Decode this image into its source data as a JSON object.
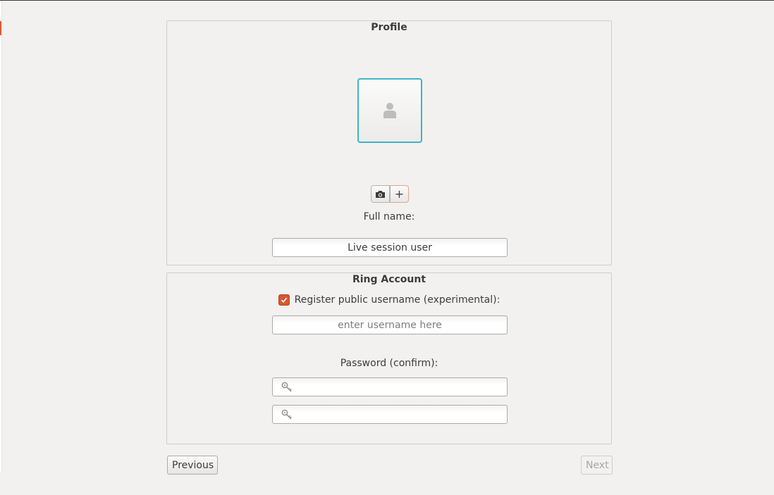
{
  "profile": {
    "title": "Profile",
    "avatar_icon": "person-icon",
    "camera_icon": "camera-icon",
    "add_symbol": "+",
    "fullname_label": "Full name:",
    "fullname_value": "Live session user"
  },
  "ring_account": {
    "title": "Ring Account",
    "register_label": "Register public username (experimental):",
    "register_checked": true,
    "username_placeholder": "enter username here",
    "username_value": "",
    "password_label": "Password (confirm):",
    "password_icon": "key-icon",
    "password_value": "",
    "password_confirm_value": ""
  },
  "nav": {
    "previous_label": "Previous",
    "next_label": "Next",
    "next_enabled": false
  },
  "colors": {
    "accent": "#d9562f",
    "avatar_border": "#3db5c6",
    "background": "#f2f1f0"
  }
}
